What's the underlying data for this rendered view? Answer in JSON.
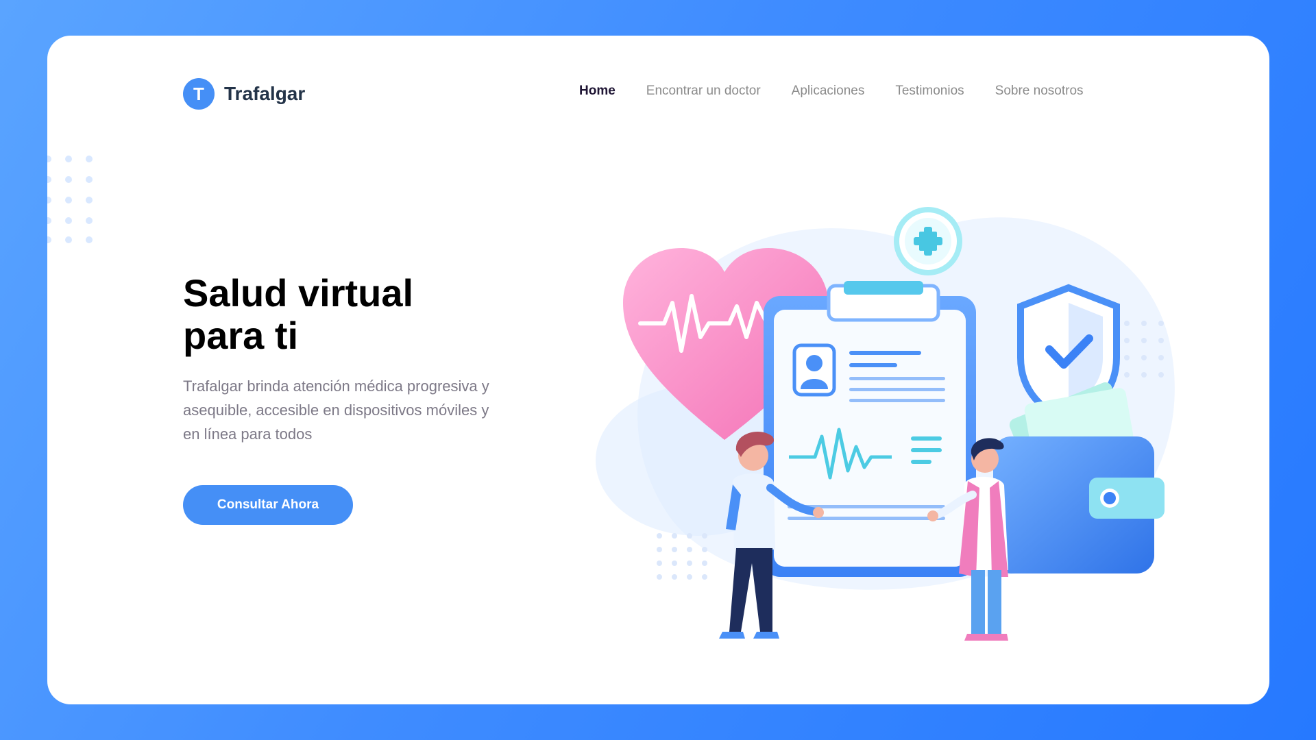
{
  "brand": {
    "initial": "T",
    "name": "Trafalgar"
  },
  "nav": {
    "items": [
      {
        "label": "Home",
        "active": true
      },
      {
        "label": "Encontrar un doctor",
        "active": false
      },
      {
        "label": "Aplicaciones",
        "active": false
      },
      {
        "label": "Testimonios",
        "active": false
      },
      {
        "label": "Sobre nosotros",
        "active": false
      }
    ]
  },
  "hero": {
    "title_line1": "Salud virtual",
    "title_line2": "para ti",
    "description": "Trafalgar brinda atención médica progresiva y asequible, accesible en dispositivos móviles y en línea para todos",
    "cta_label": "Consultar Ahora"
  },
  "illustration": {
    "icons": [
      "medical-cross-icon",
      "heart-pulse-icon",
      "shield-check-icon",
      "clipboard-icon",
      "wallet-icon"
    ]
  },
  "colors": {
    "background": "#3f8cff",
    "accent": "#458ff6",
    "heading": "#000000",
    "body_text": "#7d7987",
    "nav_inactive": "#8b8b8b"
  }
}
